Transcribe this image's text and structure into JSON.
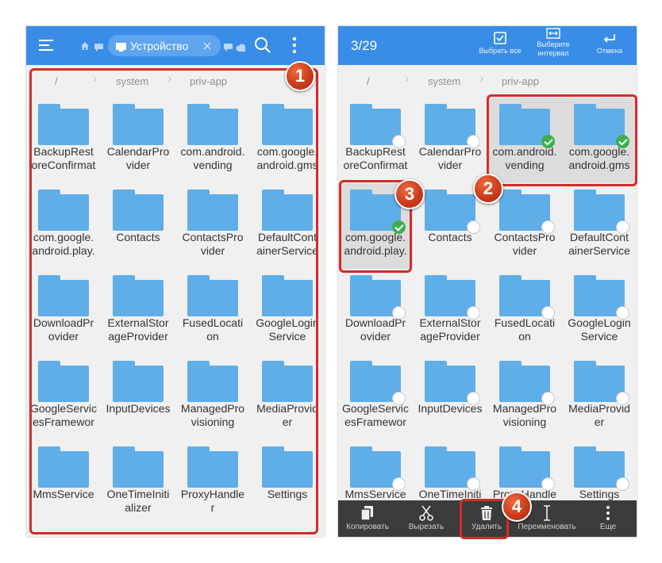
{
  "left_panel": {
    "tab_label": "Устройство",
    "breadcrumbs": [
      "/",
      "system",
      "priv-app"
    ]
  },
  "right_panel": {
    "selection_count": "3/29",
    "actions": {
      "select_all": "Выбрать все",
      "select_interval": "Выберите интервал",
      "cancel": "Отмена"
    },
    "breadcrumbs": [
      "/",
      "system",
      "priv-app"
    ],
    "bottom_actions": {
      "copy": "Копировать",
      "cut": "Вырезать",
      "delete": "Удалить",
      "rename": "Переименовать",
      "more": "Еще"
    }
  },
  "folders": [
    {
      "line1": "BackupRest",
      "line2": "oreConfirmat"
    },
    {
      "line1": "CalendarPro",
      "line2": "vider"
    },
    {
      "line1": "com.android.",
      "line2": "vending"
    },
    {
      "line1": "com.google.",
      "line2": "android.gms"
    },
    {
      "line1": "com.google.",
      "line2": "android.play."
    },
    {
      "line1": "Contacts",
      "line2": ""
    },
    {
      "line1": "ContactsPro",
      "line2": "vider"
    },
    {
      "line1": "DefaultCont",
      "line2": "ainerService"
    },
    {
      "line1": "DownloadPr",
      "line2": "ovider"
    },
    {
      "line1": "ExternalStor",
      "line2": "ageProvider"
    },
    {
      "line1": "FusedLocati",
      "line2": "on"
    },
    {
      "line1": "GoogleLogin",
      "line2": "Service"
    },
    {
      "line1": "GoogleServic",
      "line2": "esFramewor"
    },
    {
      "line1": "InputDevices",
      "line2": ""
    },
    {
      "line1": "ManagedPro",
      "line2": "visioning"
    },
    {
      "line1": "MediaProvid",
      "line2": "er"
    },
    {
      "line1": "MmsService",
      "line2": ""
    },
    {
      "line1": "OneTimeIniti",
      "line2": "alizer"
    },
    {
      "line1": "ProxyHandle",
      "line2": "r"
    },
    {
      "line1": "Settings",
      "line2": ""
    }
  ],
  "selected_folders": [
    2,
    3,
    4
  ],
  "annotations": [
    "1",
    "2",
    "3",
    "4"
  ],
  "colors": {
    "toolbar": "#3a8de6",
    "folder": "#5faee8",
    "highlight": "#d42b2b",
    "badge": "#c8391a",
    "check": "#3db04d",
    "bottom_bar": "#3c3c3c"
  }
}
